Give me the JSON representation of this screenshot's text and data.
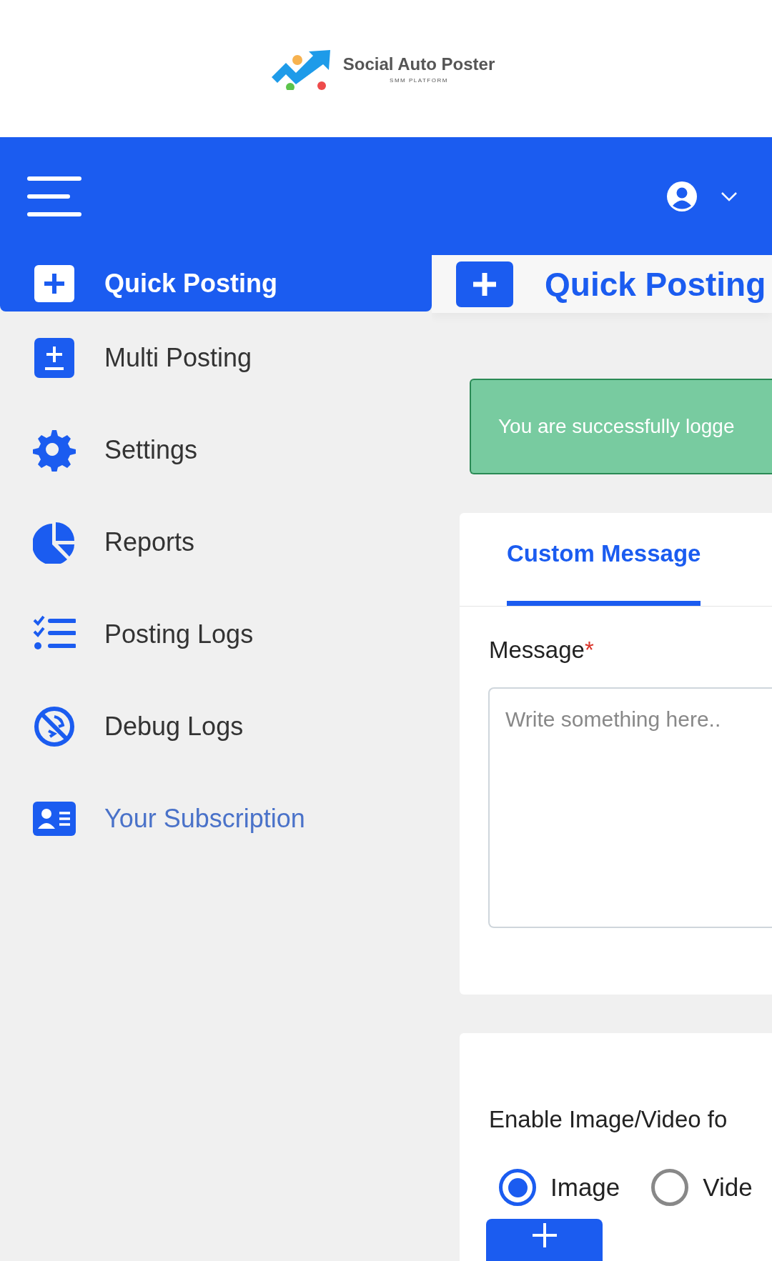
{
  "logo": {
    "name": "Social Auto Poster",
    "tagline": "SMM PLATFORM"
  },
  "sidebar": {
    "items": [
      {
        "label": "Quick Posting",
        "kind": "nav",
        "selected": true
      },
      {
        "label": "Multi Posting",
        "kind": "nav",
        "selected": false
      },
      {
        "label": "Settings",
        "kind": "nav",
        "selected": false
      },
      {
        "label": "Reports",
        "kind": "nav",
        "selected": false
      },
      {
        "label": "Posting Logs",
        "kind": "nav",
        "selected": false
      },
      {
        "label": "Debug Logs",
        "kind": "nav",
        "selected": false
      },
      {
        "label": "Your Subscription",
        "kind": "link",
        "selected": false
      }
    ]
  },
  "page_header": {
    "title": "Quick Posting"
  },
  "alert": {
    "text": "You are successfully logge"
  },
  "message_card": {
    "tabs": [
      {
        "label": "Custom Message",
        "selected": true
      }
    ],
    "label": "Message",
    "required_mark": "*",
    "placeholder": "Write something here.."
  },
  "media_card": {
    "label": "Enable Image/Video fo",
    "options": [
      {
        "label": "Image",
        "selected": true
      },
      {
        "label": "Vide",
        "selected": false
      }
    ]
  }
}
